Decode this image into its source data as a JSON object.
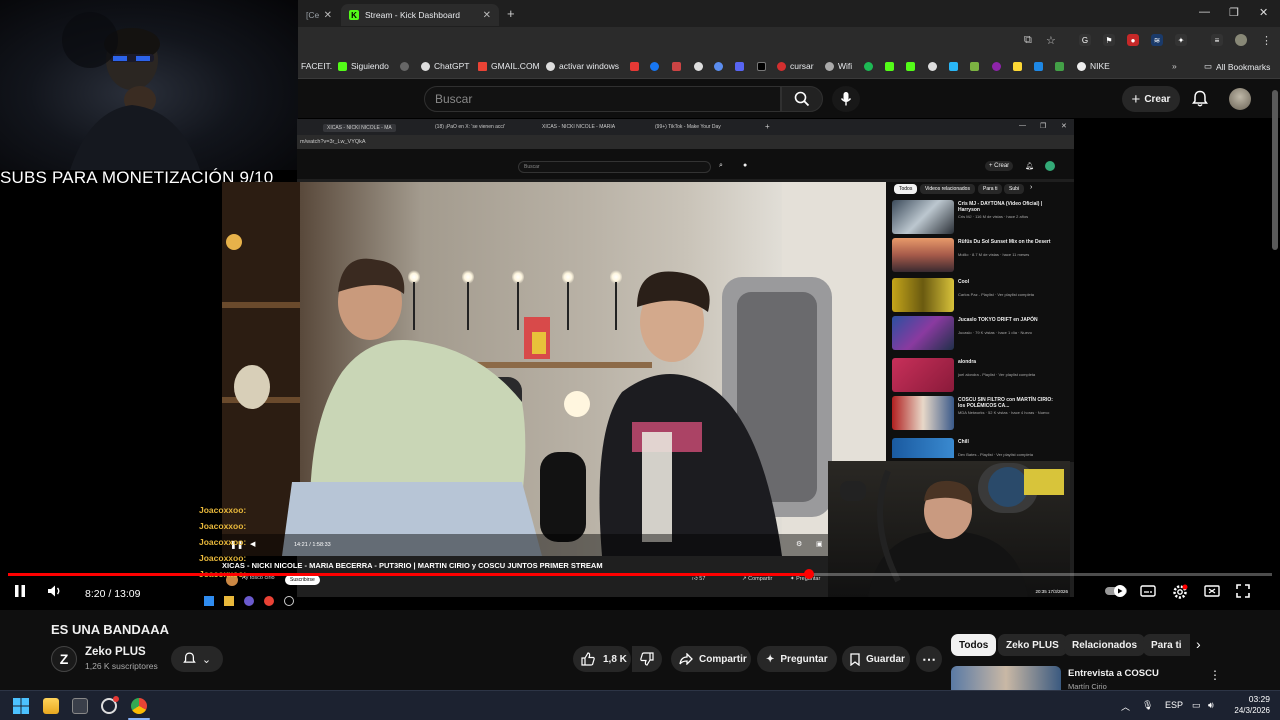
{
  "browser": {
    "tabs": [
      {
        "label": "[Ce",
        "icon": "tab-icon"
      },
      {
        "label": "Stream - Kick Dashboard",
        "icon": "kick-icon"
      }
    ],
    "bookmarks": [
      "FACEIT.",
      "Siguiendo",
      "ChatGPT",
      "GMAIL.COM",
      "activar windows",
      "cursar",
      "Wifi",
      "NIKE"
    ],
    "all_bookmarks": "All Bookmarks"
  },
  "youtube": {
    "search_placeholder": "Buscar",
    "create_label": "Crear"
  },
  "overlay": {
    "monetization_text": "SUBS PARA MONETIZACIÓN 9/10",
    "chat_lines": [
      "Joacoxxoo:",
      "Joacoxxoo:",
      "Joacoxxoo:",
      "Joacoxxoo:",
      "Joacoxxoo:"
    ]
  },
  "inner": {
    "address": "m/watch?v=3r_Lw_VYQkA",
    "search_placeholder": "Buscar",
    "create_label": "Crear",
    "tabs": [
      "XICAS - NICKI NICOLE - MA",
      "(18) ¡PaO en X: 'se vienen acci'",
      "XICAS - NICKI NICOLE - MARIA",
      "(99+) TikTok - Make Your Day"
    ],
    "video_title": "XICAS - NICKI NICOLE - MARIA BECERRA - PUT3RIO | MARTIN CIRIO y COSCU JUNTOS PRIMER STREAM",
    "inner_time": "14:21 / 1:58:33",
    "channel": "Ay tosco cirio",
    "subscribe": "Suscribirse",
    "like_count": "57",
    "share": "Compartir",
    "ask": "Preguntar",
    "chips": [
      "Todos",
      "Videos relacionados",
      "Para ti",
      "Subi"
    ],
    "sidebar": [
      {
        "title": "Cris MJ - DAYTONA (Video Oficial) | Harryson",
        "meta": "Cris MJ · 116 M de vistas · hace 2 años",
        "duration": "3:16"
      },
      {
        "title": "Rüfüs Du Sol Sunset Mix on the Desert",
        "meta": "Mollio · 8.7 M de vistas · hace 11 meses",
        "duration": "53:46"
      },
      {
        "title": "Cool",
        "meta": "Carlos Paz - Playlist · Ver playlist completa",
        "duration": ""
      },
      {
        "title": "Jucaslo TOKYO DRIFT en JAPÓN",
        "meta": "Jucaslo · 79 K vistas · hace 1 día · Nuevo",
        "duration": "19:50"
      },
      {
        "title": "alondra",
        "meta": "joel alondra - Playlist · Ver playlist completa",
        "duration": ""
      },
      {
        "title": "COSCU SIN FILTRO con MARTÍN CIRIO: los POLÉMICOS CA...",
        "meta": "MDA Networks · 52 K vistas · hace 4 horas · Nuevo",
        "duration": ""
      },
      {
        "title": "Chill",
        "meta": "Dev Bates - Playlist · Ver playlist completa",
        "duration": ""
      }
    ],
    "clock_time": "20:35",
    "clock_date": "17/3/2026"
  },
  "player": {
    "time": "8:20 / 13:09",
    "progress": 0.634
  },
  "video": {
    "title": "ES UNA BANDAAA",
    "channel_name": "Zeko PLUS",
    "subscribers": "1,26 K suscriptores",
    "likes": "1,8 K",
    "share_label": "Compartir",
    "ask_label": "Preguntar",
    "save_label": "Guardar"
  },
  "related": {
    "chips": [
      "Todos",
      "Zeko PLUS",
      "Relacionados",
      "Para ti"
    ],
    "first_title": "Entrevista a COSCU",
    "first_channel": "Martín Cirio"
  },
  "taskbar": {
    "lang": "ESP",
    "time": "03:29",
    "date": "24/3/2026"
  }
}
